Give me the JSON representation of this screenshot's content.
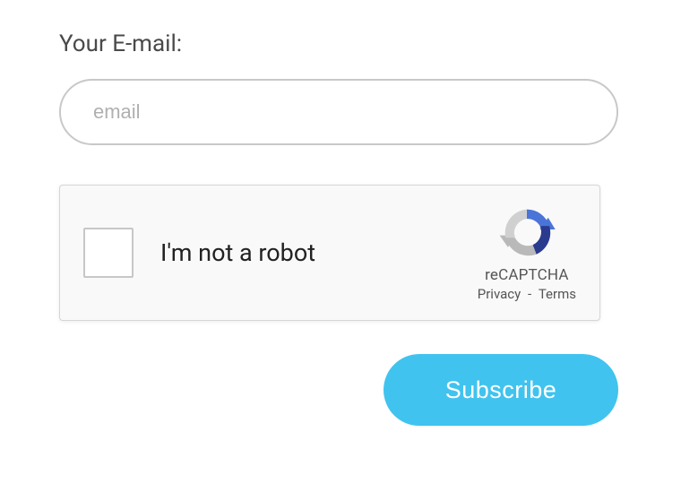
{
  "form": {
    "email_label": "Your E-mail:",
    "email_placeholder": "email",
    "email_value": ""
  },
  "recaptcha": {
    "checkbox_label": "I'm not a robot",
    "brand": "reCAPTCHA",
    "privacy_label": "Privacy",
    "terms_label": "Terms",
    "separator": " - "
  },
  "actions": {
    "subscribe_label": "Subscribe"
  }
}
